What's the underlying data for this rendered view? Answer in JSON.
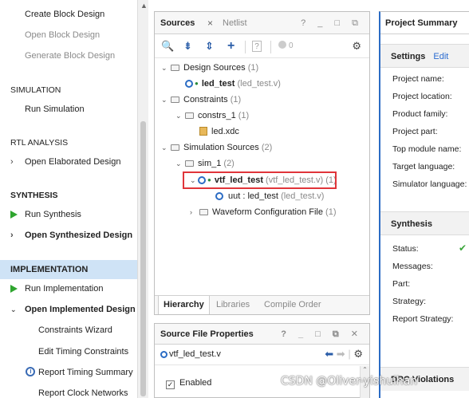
{
  "flow": {
    "create_block_design": "Create Block Design",
    "open_block_design": "Open Block Design",
    "generate_block_design": "Generate Block Design",
    "simulation": "SIMULATION",
    "run_simulation": "Run Simulation",
    "rtl_analysis": "RTL ANALYSIS",
    "open_elaborated_design": "Open Elaborated Design",
    "synthesis": "SYNTHESIS",
    "run_synthesis": "Run Synthesis",
    "open_synthesized_design": "Open Synthesized Design",
    "implementation": "IMPLEMENTATION",
    "run_implementation": "Run Implementation",
    "open_implemented_design": "Open Implemented Design",
    "constraints_wizard": "Constraints Wizard",
    "edit_timing_constraints": "Edit Timing Constraints",
    "report_timing_summary": "Report Timing Summary",
    "report_clock_networks": "Report Clock Networks"
  },
  "sources": {
    "tab_active": "Sources",
    "tab_close": "×",
    "tab_other": "Netlist",
    "window_controls": "? _ □ ⧉",
    "toolbar": {
      "search": "🔍",
      "collapse": "⇟",
      "expand": "⇕",
      "add": "+",
      "doc": "?",
      "toggle_count": "0",
      "gear": "⚙"
    },
    "tree": {
      "design_sources": "Design Sources",
      "design_sources_count": "(1)",
      "led_test": "led_test",
      "led_test_file": "(led_test.v)",
      "constraints": "Constraints",
      "constraints_count": "(1)",
      "constrs_1": "constrs_1",
      "constrs_1_count": "(1)",
      "led_xdc": "led.xdc",
      "simulation_sources": "Simulation Sources",
      "simulation_sources_count": "(2)",
      "sim_1": "sim_1",
      "sim_1_count": "(2)",
      "vtf_led_test": "vtf_led_test",
      "vtf_led_test_file": "(vtf_led_test.v) (1)",
      "uut": "uut : led_test",
      "uut_file": "(led_test.v)",
      "waveform_config": "Waveform Configuration File",
      "waveform_config_count": "(1)"
    },
    "bottom_tabs": {
      "hierarchy": "Hierarchy",
      "libraries": "Libraries",
      "compile_order": "Compile Order"
    }
  },
  "sfp": {
    "title": "Source File Properties",
    "window_controls": "? _ □ ⧉ ✕",
    "file": "vtf_led_test.v",
    "enabled_label": "Enabled",
    "enabled_checked": "✓"
  },
  "summary": {
    "title": "Project Summary",
    "settings": "Settings",
    "edit": "Edit",
    "project_name": "Project name:",
    "project_location": "Project location:",
    "product_family": "Product family:",
    "project_part": "Project part:",
    "top_module": "Top module name:",
    "target_language": "Target language:",
    "simulator_language": "Simulator language:",
    "synthesis": "Synthesis",
    "status": "Status:",
    "status_icon": "✔",
    "messages": "Messages:",
    "part": "Part:",
    "strategy": "Strategy:",
    "report_strategy": "Report Strategy:",
    "drc": "DRC Violations"
  },
  "watermark": "CSDN @Oliver-yishuihan"
}
